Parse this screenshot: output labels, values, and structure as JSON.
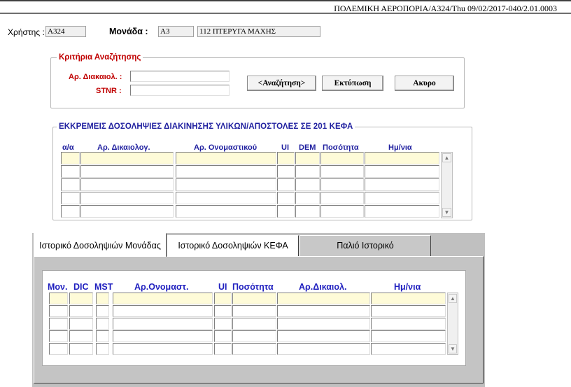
{
  "titlebar": {
    "text": "ΠΟΛΕΜΙΚΗ ΑΕΡΟΠΟΡΙΑ/A324/Thu 09/02/2017-040/2.01.0003"
  },
  "header": {
    "user_label": "Χρήστης :",
    "user_value": "A324",
    "unit_label": "Μονάδα :",
    "unit_code": "A3",
    "unit_name": "112 ΠΤΕΡΥΓΑ ΜΑΧΗΣ"
  },
  "search": {
    "title": "Κριτήρια Αναζήτησης",
    "doc_label": "Αρ. Διακαιολ. :",
    "doc_value": "",
    "stnr_label": "STNR :",
    "stnr_value": "",
    "search_button": "<Αναζήτηση>",
    "print_button": "Εκτύπωση",
    "cancel_button": "Ακυρο"
  },
  "pending": {
    "title": "ΕΚΚΡΕΜΕΙΣ ΔΟΣΟΛΗΨΙΕΣ ΔΙΑΚΙΝΗΣΗΣ ΥΛΙΚΩΝ/ΑΠΟΣΤΟΛΕΣ ΣΕ 201 ΚΕΦΑ",
    "columns": [
      "α/α",
      "Αρ. Δικαιολογ.",
      "Αρ. Ονομαστικού",
      "UI",
      "DEM",
      "Ποσότητα",
      "Ημ/νια"
    ],
    "rows": 5
  },
  "tabs": {
    "items": [
      "Ιστορικό Δοσοληψιών Μονάδας",
      "Ιστορικό Δοσοληψιών ΚΕΦΑ",
      "Παλιό Ιστορικό"
    ],
    "active": 0
  },
  "history": {
    "columns": [
      "Μον.",
      "DIC",
      "MST",
      "Αρ.Ονομαστ.",
      "UI",
      "Ποσότητα",
      "Αρ.Δικαιολ.",
      "Ημ/νια"
    ],
    "rows": 5
  },
  "icons": {
    "scroll_up": "scroll-up-arrow-icon",
    "scroll_down": "scroll-down-arrow-icon"
  }
}
